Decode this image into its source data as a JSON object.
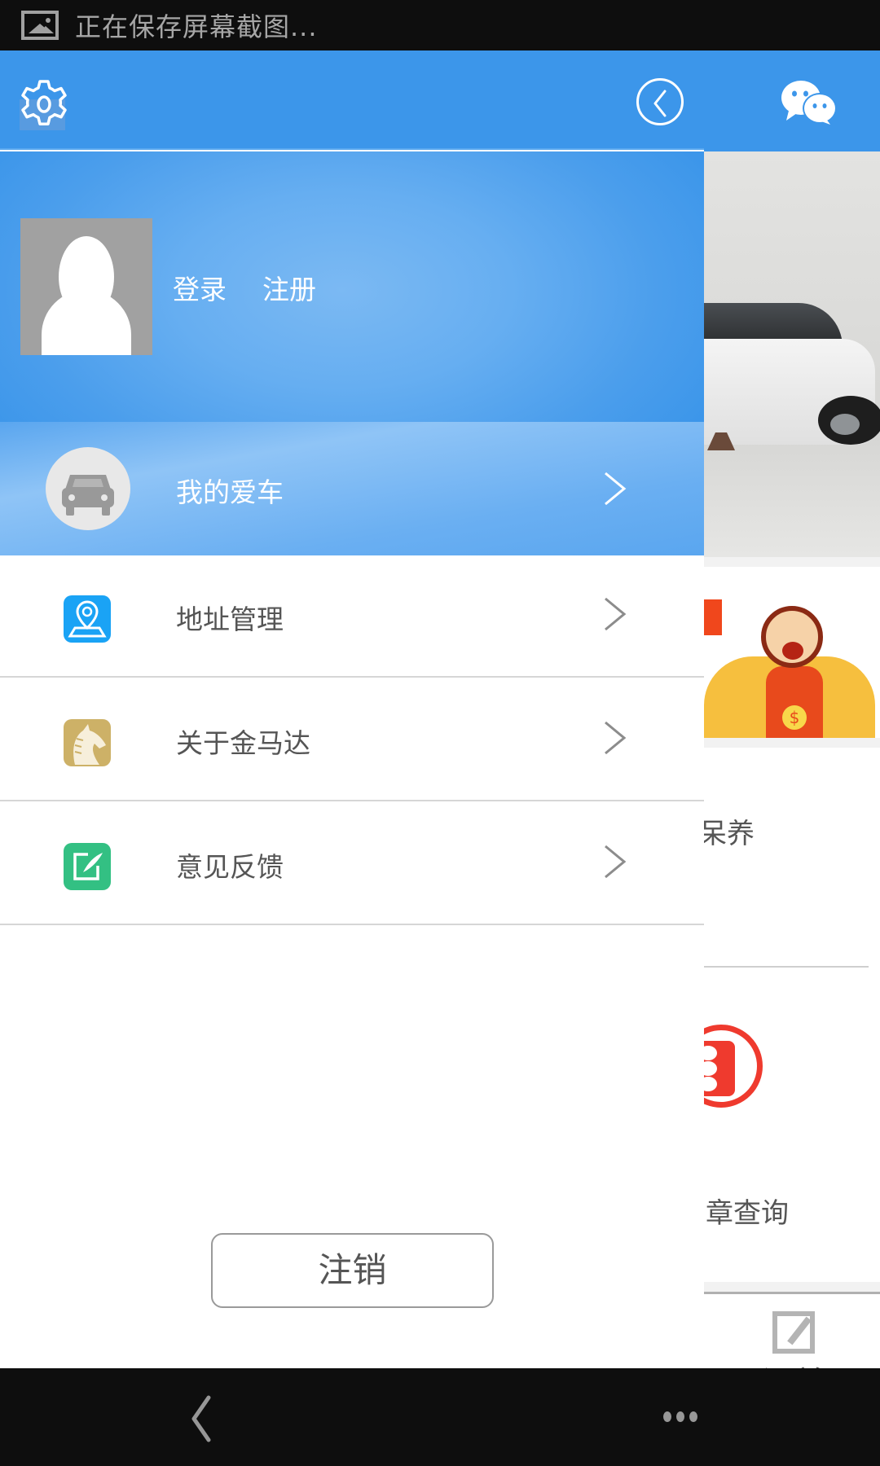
{
  "status_bar": {
    "notification_icon": "image-icon",
    "notification_text": "正在保存屏幕截图..."
  },
  "drawer": {
    "header": {
      "settings_icon": "gear-icon",
      "collapse_icon": "circle-chevron-left-icon"
    },
    "profile": {
      "avatar_icon": "default-user-avatar",
      "login_label": "登录",
      "register_label": "注册"
    },
    "menu": [
      {
        "label": "我的爱车",
        "icon": "car-icon",
        "active": true
      },
      {
        "label": "地址管理",
        "icon": "map-pin-icon",
        "icon_color": "#1aa3f5",
        "active": false
      },
      {
        "label": "关于金马达",
        "icon": "horse-logo-icon",
        "icon_color": "#cdb167",
        "active": false
      },
      {
        "label": "意见反馈",
        "icon": "edit-feedback-icon",
        "icon_color": "#33c083",
        "active": false
      }
    ],
    "logout_label": "注销"
  },
  "main_page": {
    "header_icon": "wechat-icon",
    "banner_1": "car-promo-image",
    "banner_2": "red-packet-promo-image",
    "grid_items": [
      {
        "label": "保养",
        "visible_text": "呆养"
      },
      {
        "label": "违章查询",
        "visible_text": "章查询",
        "icon": "traffic-light-icon"
      }
    ],
    "tab_bar": [
      {
        "label": "订单",
        "icon": "order-edit-icon"
      }
    ]
  },
  "nav_bar": {
    "back_icon": "back-chevron-icon",
    "more_icon": "more-dots-icon"
  },
  "colors": {
    "primary_blue": "#3c96ea",
    "status_bar_bg": "#0e0e0e",
    "divider": "#d6d6d6",
    "text_gray": "#555555"
  }
}
